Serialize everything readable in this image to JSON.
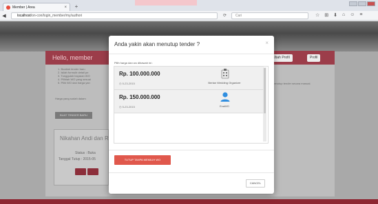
{
  "browser": {
    "tab_title": "Member | Area",
    "tab_close": "×",
    "new_tab": "+",
    "url_domain": "localhost",
    "url_path": "/on-con/login_member/my/authori",
    "search_placeholder": "Cari",
    "refresh_icon": "refresh-icon",
    "toolbar_icons": [
      "☆",
      "⊞",
      "⬇",
      "⌂",
      "☺",
      "≡"
    ]
  },
  "page": {
    "hello": "Hello, member",
    "header_buttons": [
      "Ubah Profil",
      "Profil"
    ],
    "bullets": [
      "1. Buatlah tender baru",
      "2. Isilah formulir detail pe",
      "3. Tunggulah bayaran WO",
      "4. Pilihlah WO yang sesuai",
      "5. Pilih WO dan harga yan"
    ],
    "note": "Harga yang sudah dalam",
    "side_text": "menutup tender secara manual.",
    "new_tender_button": "BUAT TENDER BARU",
    "card_name": "Nikahan Andi dan Ri",
    "card_status_label": "Status :",
    "card_status_value": "Buka",
    "card_date_label": "Tanggal Tutup :",
    "card_date_value": "2015-05"
  },
  "modal": {
    "title": "Anda yakin akan menutup tender ?",
    "close": "×",
    "list_label": "Pilih harga dan wo dibawah ini :",
    "bids": [
      {
        "price": "Rp. 100.000.000",
        "date": "5-23-2015",
        "organizer": "Bertan Wedding Organizer",
        "icon": "building-icon"
      },
      {
        "price": "Rp. 150.000.000",
        "date": "5-23-2015",
        "organizer": "EvaWO",
        "icon": "user-icon"
      }
    ],
    "close_without_wo": "TUTUP TANPA MEMILIH WO",
    "cancel": "CANCEL"
  },
  "colors": {
    "accent": "#9c3d4a",
    "button_red": "#e0584c"
  }
}
